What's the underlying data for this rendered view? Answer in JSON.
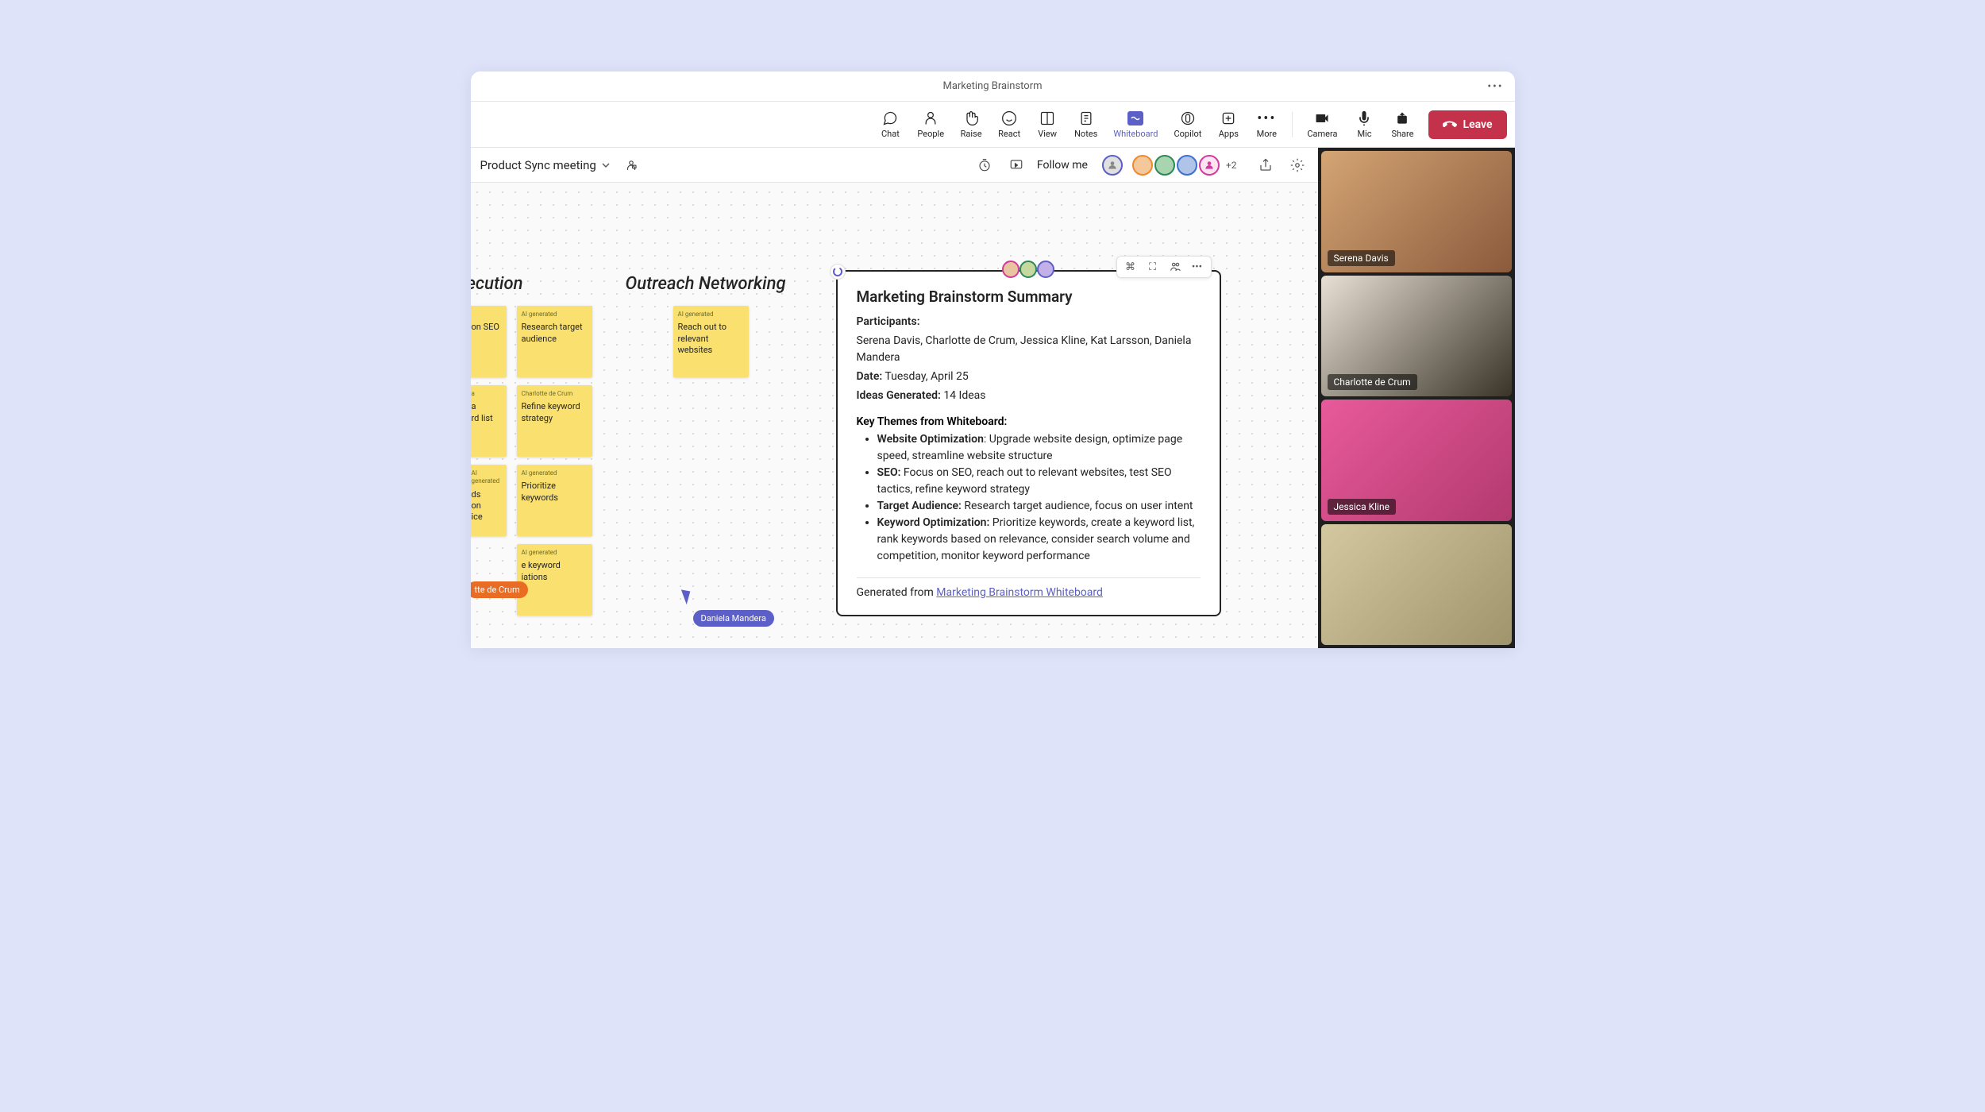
{
  "titlebar": {
    "title": "Marketing Brainstorm"
  },
  "toolbar": {
    "items": [
      {
        "label": "Chat"
      },
      {
        "label": "People"
      },
      {
        "label": "Raise"
      },
      {
        "label": "React"
      },
      {
        "label": "View"
      },
      {
        "label": "Notes"
      },
      {
        "label": "Whiteboard"
      },
      {
        "label": "Copilot"
      },
      {
        "label": "Apps"
      },
      {
        "label": "More"
      }
    ],
    "right_items": [
      {
        "label": "Camera"
      },
      {
        "label": "Mic"
      },
      {
        "label": "Share"
      }
    ],
    "leave": "Leave"
  },
  "wb_header": {
    "title": "Product Sync meeting",
    "follow_me": "Follow me",
    "overflow": "+2"
  },
  "sections": {
    "execution": "ecution",
    "outreach": "Outreach Networking"
  },
  "stickies": {
    "ai_tag": "AI generated",
    "author_tag": "Charlotte de Crum",
    "s1a": "on SEO",
    "s1b": "Research target audience",
    "s2a": "a\nrd list",
    "s2b": "Refine keyword strategy",
    "s3a": "ds\non\nice",
    "s3b": "Prioritize keywords",
    "s4b": "e keyword\niations",
    "outreach1": "Reach out to relevant websites"
  },
  "cursors": {
    "orange": "tte de Crum",
    "blue": "Daniela Mandera"
  },
  "summary": {
    "title": "Marketing Brainstorm Summary",
    "participants_label": "Participants:",
    "participants": "Serena Davis, Charlotte de Crum, Jessica Kline, Kat Larsson, Daniela Mandera",
    "date_label": "Date:",
    "date": "Tuesday, April 25",
    "ideas_label": "Ideas Generated:",
    "ideas": "14 Ideas",
    "themes_label": "Key Themes from Whiteboard:",
    "bullets": [
      {
        "b": "Website Optimization",
        "t": ": Upgrade website design, optimize page speed, streamline website structure"
      },
      {
        "b": "SEO:",
        "t": " Focus on SEO, reach out to relevant websites, test SEO tactics, refine keyword strategy"
      },
      {
        "b": "Target Audience:",
        "t": " Research target audience, focus on user intent"
      },
      {
        "b": "Keyword Optimization:",
        "t": " Prioritize keywords, create a keyword list, rank keywords based on relevance, consider search volume and competition, monitor keyword performance"
      }
    ],
    "gen_prefix": "Generated from ",
    "gen_link": "Marketing Brainstorm Whiteboard"
  },
  "participants_video": [
    {
      "name": "Serena Davis",
      "bg": "linear-gradient(135deg,#d4a574 0%,#8b5a3c 100%)"
    },
    {
      "name": "Charlotte de Crum",
      "bg": "linear-gradient(135deg,#e8e0d4 0%,#3a3428 100%)"
    },
    {
      "name": "Jessica Kline",
      "bg": "linear-gradient(135deg,#e85a9b 0%,#b33a6f 100%)"
    },
    {
      "name": "",
      "bg": "linear-gradient(135deg,#d4c8a0 0%,#a0946c 100%)"
    }
  ]
}
